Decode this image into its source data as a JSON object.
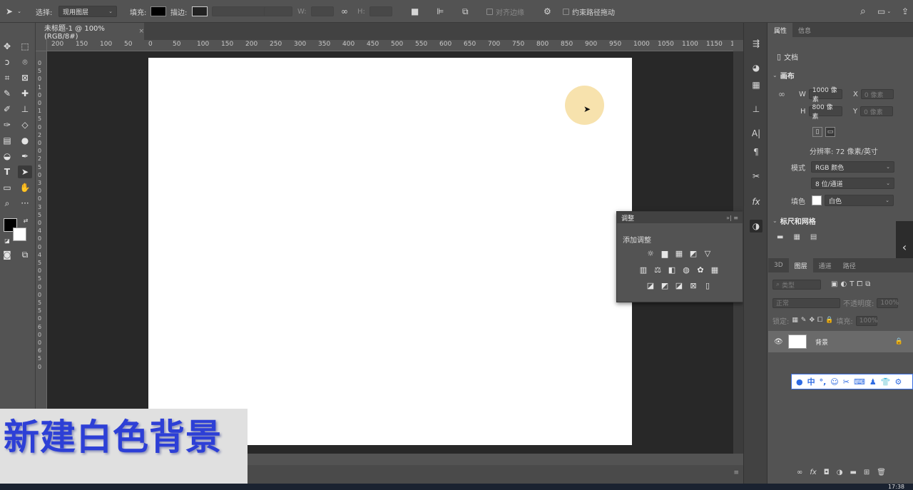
{
  "options_bar": {
    "select_label": "选择:",
    "select_value": "现用图层",
    "fill_label": "填充:",
    "stroke_label": "描边:",
    "w_label": "W:",
    "h_label": "H:",
    "align_edges": "对齐边缘",
    "constrain_path": "约束路径拖动"
  },
  "doc_tab": {
    "title": "未标题-1 @ 100%(RGB/8#)",
    "close": "×"
  },
  "ruler": {
    "h_ticks": [
      "200",
      "150",
      "100",
      "50",
      "0",
      "50",
      "100",
      "150",
      "200",
      "250",
      "300",
      "350",
      "400",
      "450",
      "500",
      "550",
      "600",
      "650",
      "700",
      "750",
      "800",
      "850",
      "900",
      "950",
      "1000",
      "1050",
      "1100",
      "1150",
      "1"
    ],
    "v_ticks": [
      "0",
      "5",
      "0",
      "1",
      "0",
      "0",
      "1",
      "5",
      "0",
      "2",
      "0",
      "0",
      "2",
      "5",
      "0",
      "3",
      "0",
      "0",
      "3",
      "5",
      "0",
      "4",
      "0",
      "0",
      "4",
      "5",
      "0",
      "5",
      "0",
      "0",
      "5",
      "5",
      "0",
      "6",
      "0",
      "0",
      "6",
      "5",
      "0"
    ]
  },
  "caption": "新建白色背景",
  "properties": {
    "tab_properties": "属性",
    "tab_info": "信息",
    "doc_label": "文档",
    "canvas_section": "画布",
    "w_label": "W",
    "w_value": "1000 像素",
    "h_label": "H",
    "h_value": "800 像素",
    "x_label": "X",
    "x_placeholder": "0 像素",
    "y_label": "Y",
    "y_placeholder": "0 像素",
    "resolution": "分辨率: 72 像素/英寸",
    "mode_label": "模式",
    "mode_value": "RGB 颜色",
    "depth_value": "8 位/通道",
    "fill_label": "填色",
    "fill_value": "白色",
    "rulers_section": "标尺和网格"
  },
  "adjustments": {
    "title": "调整",
    "subtitle": "添加调整"
  },
  "layers": {
    "tab_3d": "3D",
    "tab_layers": "图层",
    "tab_channels": "通道",
    "tab_paths": "路径",
    "kind_label": "类型",
    "blend_mode": "正常",
    "opacity_label": "不透明度:",
    "opacity_value": "100%",
    "lock_label": "锁定:",
    "fill_label": "填充:",
    "fill_value": "100%",
    "layer_name": "背景"
  },
  "ime": {
    "lang": "中"
  },
  "taskbar": {
    "clock": "17:38"
  }
}
